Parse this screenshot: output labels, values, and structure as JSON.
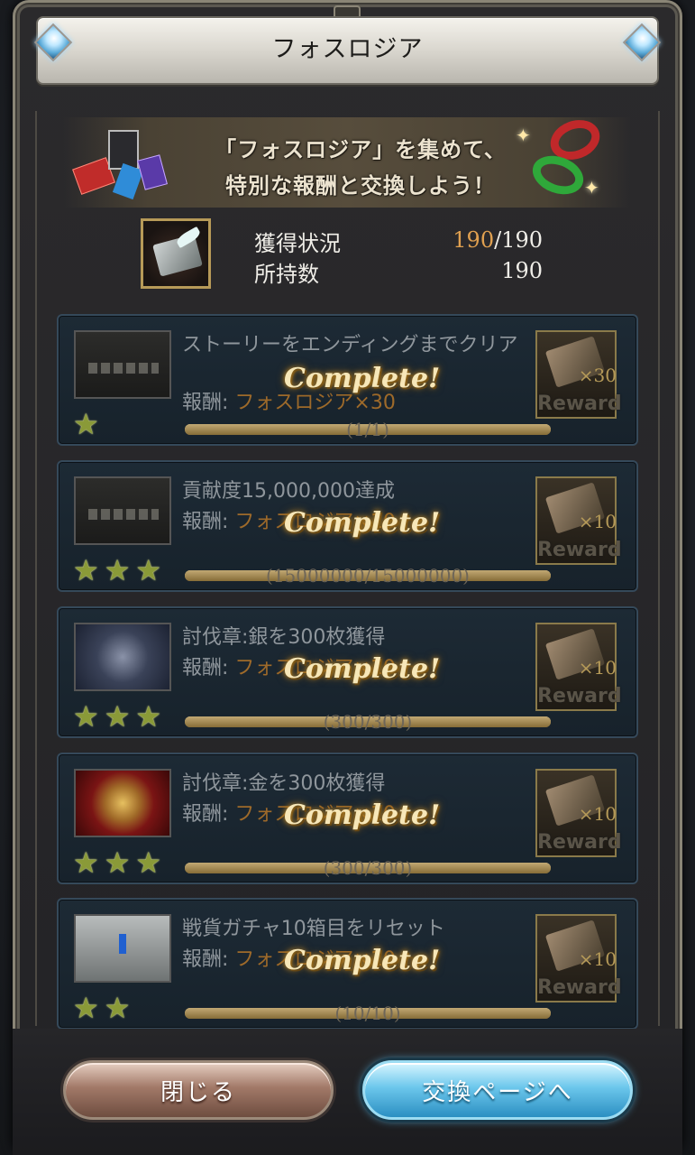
{
  "window": {
    "title": "フォスロジア"
  },
  "banner": {
    "line1": "「フォスロジア」を集めて、",
    "line2": "特別な報酬と交換しよう！"
  },
  "status": {
    "acquired_label": "獲得状況",
    "acquired_current": "190",
    "acquired_total": "/190",
    "owned_label": "所持数",
    "owned_value": "190"
  },
  "missions": [
    {
      "desc": "ストーリーをエンディングまでクリア",
      "reward_label": "報酬:",
      "reward_value": "フォスロジア×30",
      "complete": "Complete!",
      "stars": 1,
      "progress_text": "(1/1)",
      "progress": 1.0,
      "reward_qty": "×30",
      "reward_box_label": "Reward",
      "thumb": "dark-text"
    },
    {
      "desc": "貢献度15,000,000達成",
      "reward_label": "報酬:",
      "reward_value": "フォスロジア×10",
      "complete": "Complete!",
      "stars": 3,
      "progress_text": "(15000000/15000000)",
      "progress": 1.0,
      "reward_qty": "×10",
      "reward_box_label": "Reward",
      "thumb": "dark-text"
    },
    {
      "desc": "討伐章:銀を300枚獲得",
      "reward_label": "報酬:",
      "reward_value": "フォスロジア×10",
      "complete": "Complete!",
      "stars": 3,
      "progress_text": "(300/300)",
      "progress": 1.0,
      "reward_qty": "×10",
      "reward_box_label": "Reward",
      "thumb": "silver"
    },
    {
      "desc": "討伐章:金を300枚獲得",
      "reward_label": "報酬:",
      "reward_value": "フォスロジア×10",
      "complete": "Complete!",
      "stars": 3,
      "progress_text": "(300/300)",
      "progress": 1.0,
      "reward_qty": "×10",
      "reward_box_label": "Reward",
      "thumb": "gold"
    },
    {
      "desc": "戦貨ガチャ10箱目をリセット",
      "reward_label": "報酬:",
      "reward_value": "フォスロジア×10",
      "complete": "Complete!",
      "stars": 2,
      "progress_text": "(10/10)",
      "progress": 1.0,
      "reward_qty": "×10",
      "reward_box_label": "Reward",
      "thumb": "ruins"
    }
  ],
  "buttons": {
    "close": "閉じる",
    "exchange": "交換ページへ"
  },
  "colors": {
    "accent_orange": "#e0a050",
    "close_button": "#a27968",
    "exchange_button": "#6cc7ec"
  }
}
